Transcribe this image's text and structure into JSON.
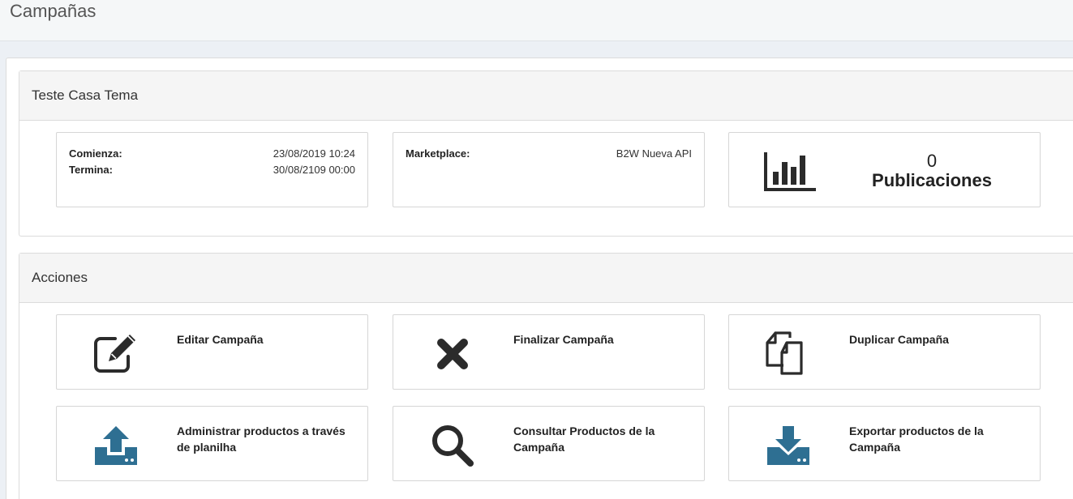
{
  "page": {
    "title": "Campañas"
  },
  "campaign": {
    "name": "Teste Casa Tema",
    "start_label": "Comienza:",
    "start_value": "23/08/2019 10:24",
    "end_label": "Termina:",
    "end_value": "30/08/2109 00:00",
    "marketplace_label": "Marketplace:",
    "marketplace_value": "B2W Nueva API",
    "publications_count": "0",
    "publications_label": "Publicaciones"
  },
  "actions": {
    "title": "Acciones",
    "edit": "Editar Campaña",
    "finish": "Finalizar Campaña",
    "duplicate": "Duplicar Campaña",
    "manage_sheet": "Administrar productos a través de planilha",
    "view_products": "Consultar Productos de la Campaña",
    "export_products": "Exportar productos de la Campaña"
  },
  "icons": {
    "chart": "bar-chart-icon",
    "edit": "edit-icon",
    "finish": "close-icon",
    "duplicate": "copy-icon",
    "upload": "upload-icon",
    "search": "search-icon",
    "download": "download-icon"
  },
  "colors": {
    "accent": "#2e6f92",
    "icon_dark": "#2b2b2b"
  }
}
